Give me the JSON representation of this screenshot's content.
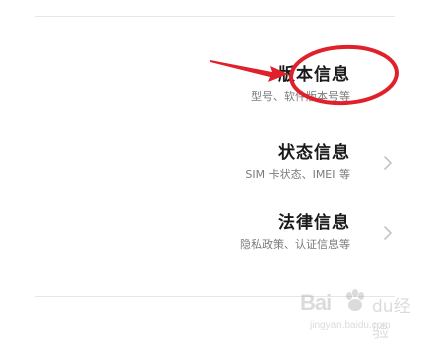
{
  "settings": {
    "items": [
      {
        "title": "版本信息",
        "subtitle": "型号、软件版本号等"
      },
      {
        "title": "状态信息",
        "subtitle": "SIM 卡状态、IMEI 等"
      },
      {
        "title": "法律信息",
        "subtitle": "隐私政策、认证信息等"
      }
    ]
  },
  "annotation": {
    "color": "#e0202a"
  },
  "watermark": {
    "brand": "Bai",
    "suffix": "du",
    "text": "经验",
    "url": "jingyan.baidu.com"
  }
}
